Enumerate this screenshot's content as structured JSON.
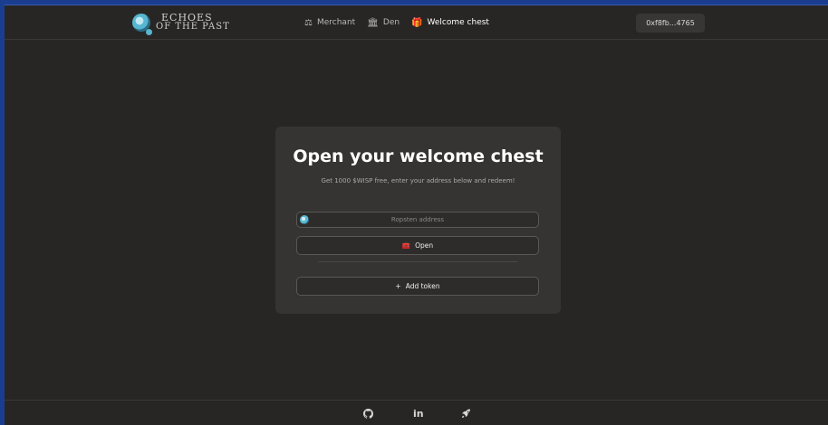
{
  "header": {
    "logo": {
      "line1": "ECHOES",
      "line2": "OF THE PAST"
    },
    "nav": [
      {
        "label": "Merchant",
        "icon": "balance-scale-icon"
      },
      {
        "label": "Den",
        "icon": "building-icon"
      },
      {
        "label": "Welcome chest",
        "icon": "gift-icon",
        "active": true
      }
    ],
    "wallet_address": "0xf8fb...4765"
  },
  "card": {
    "title": "Open your welcome chest",
    "subtitle": "Get 1000 $WISP free, enter your address below and redeem!",
    "address_placeholder": "Ropsten address",
    "address_value": "",
    "open_label": "Open",
    "add_token_label": "Add token"
  },
  "footer": {
    "icons": [
      "github-icon",
      "linkedin-icon",
      "rocket-icon"
    ],
    "linkedin_text": "in"
  },
  "colors": {
    "background": "#282624",
    "card": "#363432",
    "frame": "#1a3d8f"
  }
}
